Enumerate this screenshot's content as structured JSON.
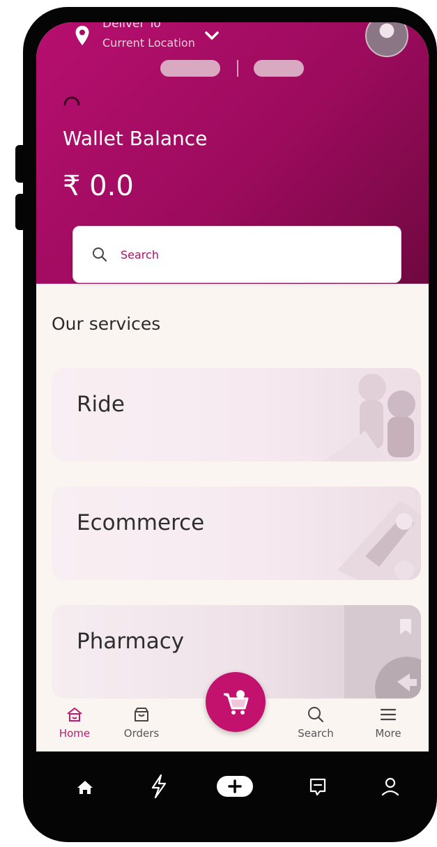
{
  "header": {
    "deliver_to": "Deliver To",
    "current_location": "Current Location",
    "wallet_label": "Wallet Balance",
    "wallet_amount": "₹ 0.0"
  },
  "search": {
    "placeholder": "Search"
  },
  "services": {
    "title": "Our services",
    "items": [
      {
        "label": "Ride"
      },
      {
        "label": "Ecommerce"
      },
      {
        "label": "Pharmacy"
      }
    ]
  },
  "bottom_nav": {
    "items": [
      {
        "label": "Home",
        "icon": "home-icon"
      },
      {
        "label": "Orders",
        "icon": "orders-icon"
      },
      {
        "label": "Search",
        "icon": "search-icon"
      },
      {
        "label": "More",
        "icon": "menu-icon"
      }
    ],
    "fab_icon": "cart-icon"
  },
  "system_nav": {
    "icons": [
      "home-icon",
      "lightning-icon",
      "plus-icon",
      "message-icon",
      "profile-icon"
    ]
  },
  "colors": {
    "brand": "#b70f6f",
    "brand_dark": "#6f0840",
    "background": "#fbf5f1",
    "active_nav": "#c2186f"
  }
}
